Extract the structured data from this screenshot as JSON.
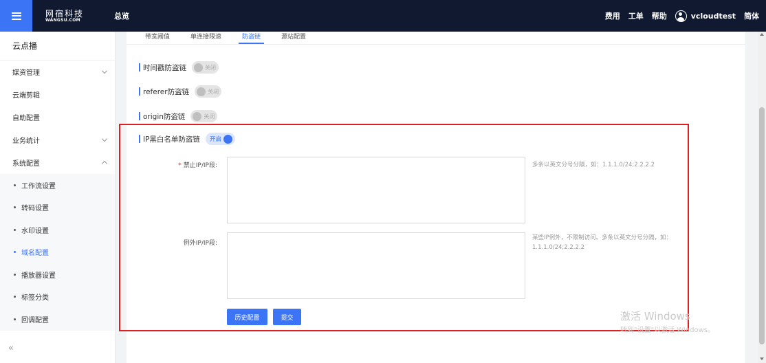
{
  "colors": {
    "accent": "#3b74f5",
    "topbar": "#10192f",
    "highlight_border": "#e02020"
  },
  "header": {
    "logo_cn": "网宿科技",
    "logo_en": "WANGSU.COM",
    "overview": "总览",
    "links": [
      "费用",
      "工单",
      "帮助"
    ],
    "username": "vcloudtest",
    "language": "简体"
  },
  "sidebar": {
    "title": "云点播",
    "items": [
      {
        "label": "媒资管理",
        "chevron": "down"
      },
      {
        "label": "云端剪辑"
      },
      {
        "label": "自助配置"
      },
      {
        "label": "业务统计",
        "chevron": "down"
      },
      {
        "label": "系统配置",
        "chevron": "up"
      }
    ],
    "sub_items": [
      {
        "label": "工作流设置"
      },
      {
        "label": "转码设置"
      },
      {
        "label": "水印设置"
      },
      {
        "label": "域名配置",
        "active": true
      },
      {
        "label": "播放器设置"
      },
      {
        "label": "标签分类"
      },
      {
        "label": "回调配置"
      }
    ],
    "collapse_icon": "«"
  },
  "tabs": [
    "带宽阈值",
    "单连接限速",
    "防盗链",
    "源站配置"
  ],
  "active_tab": "防盗链",
  "settings": {
    "timestamp": {
      "label": "时间戳防盗链",
      "state": "关闭"
    },
    "referer": {
      "label": "referer防盗链",
      "state": "关闭"
    },
    "origin": {
      "label": "origin防盗链",
      "state": "关闭"
    },
    "ip_list": {
      "label": "IP黑白名单防盗链",
      "state": "开启"
    }
  },
  "form": {
    "required_mark": "*",
    "blocked_label": "禁止IP/IP段:",
    "blocked_value": "",
    "blocked_hint": "多条以英文分号分隔，如：1.1.1.0/24;2.2.2.2",
    "exception_label": "例外IP/IP段:",
    "exception_value": "",
    "exception_hint": "某些IP例外，不限制访问。多条以英文分号分隔，如：1.1.1.0/24;2.2.2.2",
    "history_button": "历史配置",
    "submit_button": "提交"
  },
  "watermark": {
    "line1": "激活 Windows",
    "line2": "转到\"设置\"以激活 Windows。"
  }
}
